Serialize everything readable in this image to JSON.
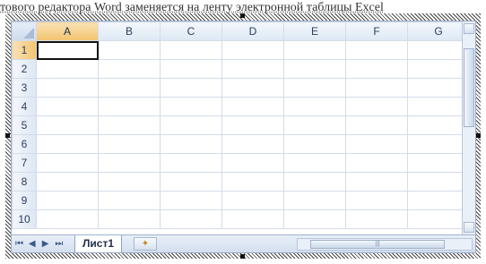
{
  "document": {
    "text_line": "тового редактора Word заменяется на ленту электронной таблицы Excel"
  },
  "spreadsheet": {
    "columns": [
      "A",
      "B",
      "C",
      "D",
      "E",
      "F",
      "G"
    ],
    "rows": [
      "1",
      "2",
      "3",
      "4",
      "5",
      "6",
      "7",
      "8",
      "9",
      "10"
    ],
    "selected_cell": "A1",
    "active_column": "A",
    "active_row": "1"
  },
  "sheet_tabs": {
    "nav": [
      "⏮",
      "◀",
      "▶",
      "⏭"
    ],
    "active_tab": "Лист1",
    "insert_icon": "insert-sheet-icon"
  },
  "colors": {
    "header_bg": "#dde7f3",
    "active_header": "#f2c46f",
    "grid_line": "#d4dce8"
  }
}
